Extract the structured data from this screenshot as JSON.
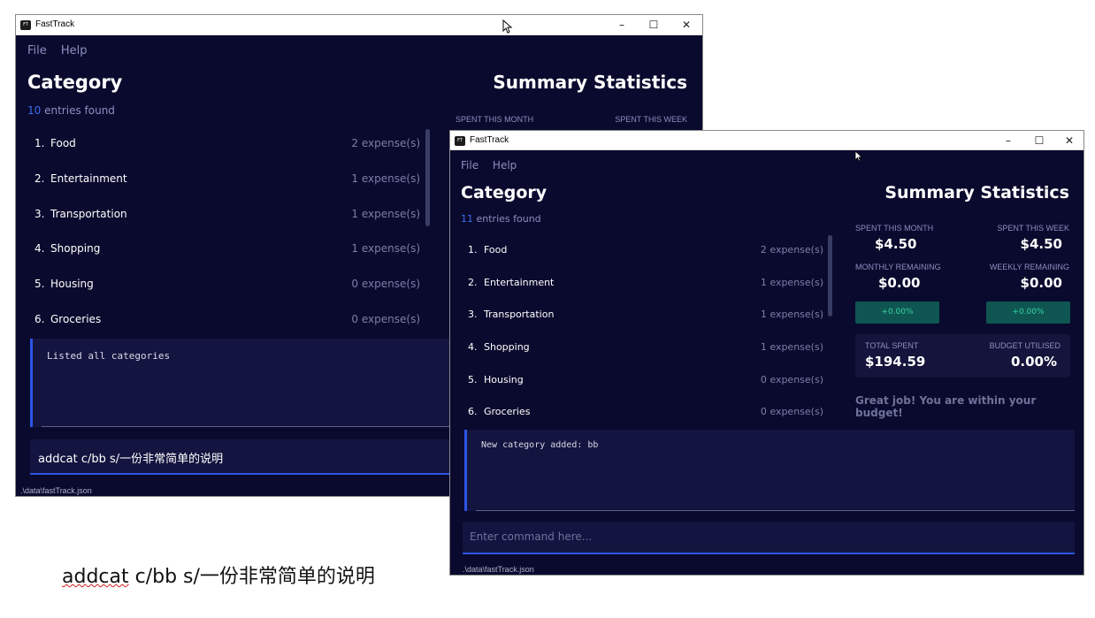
{
  "back": {
    "title": "FastTrack",
    "menu": [
      "File",
      "Help"
    ],
    "category_heading": "Category",
    "summary_heading": "Summary Statistics",
    "entries_count": "10",
    "entries_suffix": "entries found",
    "stat_labels": [
      "SPENT THIS MONTH",
      "SPENT THIS WEEK"
    ],
    "categories": [
      {
        "idx": "1.",
        "name": "Food",
        "count": "2 expense(s)"
      },
      {
        "idx": "2.",
        "name": "Entertainment",
        "count": "1 expense(s)"
      },
      {
        "idx": "3.",
        "name": "Transportation",
        "count": "1 expense(s)"
      },
      {
        "idx": "4.",
        "name": "Shopping",
        "count": "1 expense(s)"
      },
      {
        "idx": "5.",
        "name": "Housing",
        "count": "0 expense(s)"
      },
      {
        "idx": "6.",
        "name": "Groceries",
        "count": "0 expense(s)"
      }
    ],
    "result": "Listed all categories",
    "command": "addcat c/bb s/一份非常简单的说明",
    "status": ".\\data\\fastTrack.json"
  },
  "front": {
    "title": "FastTrack",
    "menu": [
      "File",
      "Help"
    ],
    "category_heading": "Category",
    "summary_heading": "Summary Statistics",
    "entries_count": "11",
    "entries_suffix": "entries found",
    "categories": [
      {
        "idx": "1.",
        "name": "Food",
        "count": "2 expense(s)"
      },
      {
        "idx": "2.",
        "name": "Entertainment",
        "count": "1 expense(s)"
      },
      {
        "idx": "3.",
        "name": "Transportation",
        "count": "1 expense(s)"
      },
      {
        "idx": "4.",
        "name": "Shopping",
        "count": "1 expense(s)"
      },
      {
        "idx": "5.",
        "name": "Housing",
        "count": "0 expense(s)"
      },
      {
        "idx": "6.",
        "name": "Groceries",
        "count": "0 expense(s)"
      }
    ],
    "stats": {
      "spent_month_label": "SPENT THIS MONTH",
      "spent_month": "$4.50",
      "spent_week_label": "SPENT THIS WEEK",
      "spent_week": "$4.50",
      "monthly_remaining_label": "MONTHLY REMAINING",
      "monthly_remaining": "$0.00",
      "weekly_remaining_label": "WEEKLY REMAINING",
      "weekly_remaining": "$0.00",
      "monthly_change": "+0.00%",
      "weekly_change": "+0.00%",
      "total_spent_label": "TOTAL SPENT",
      "total_spent": "$194.59",
      "budget_utilised_label": "BUDGET UTILISED",
      "budget_utilised": "0.00%"
    },
    "message": "Great job! You are within your budget!",
    "result": "New category added: bb",
    "command_placeholder": "Enter command here...",
    "status": ".\\data\\fastTrack.json"
  },
  "caption": {
    "prefix": "addcat",
    "rest": " c/bb s/一份非常简单的说明"
  },
  "colors": {
    "bg": "#0a0a2e",
    "accent": "#2e55e6",
    "positive": "#37d6a0"
  }
}
